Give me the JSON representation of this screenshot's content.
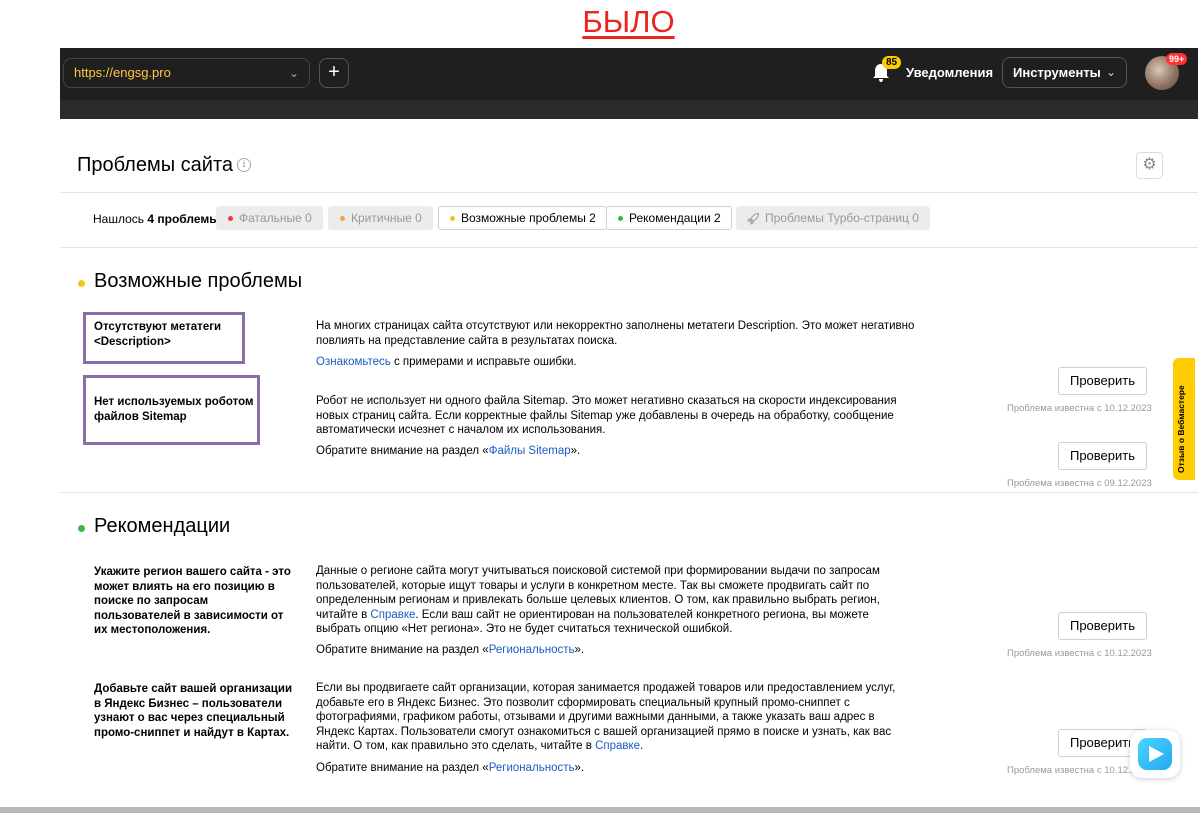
{
  "slide_title": "БЫЛО",
  "header": {
    "url": "https://engsg.pro",
    "notifications": {
      "count": "85",
      "label": "Уведомления"
    },
    "tools_label": "Инструменты",
    "avatar_badge": "99+"
  },
  "page": {
    "title": "Проблемы сайта",
    "found_prefix": "Нашлось",
    "found_count": "4 проблемы",
    "filters": [
      {
        "label": "Фатальные 0",
        "color": "#f03c3c",
        "active": false
      },
      {
        "label": "Критичные 0",
        "color": "#f5a54a",
        "active": false
      },
      {
        "label": "Возможные проблемы 2",
        "color": "#f5c518",
        "active": true
      },
      {
        "label": "Рекомендации 2",
        "color": "#3cb84a",
        "active": true
      },
      {
        "label": "Проблемы Турбо-страниц 0",
        "icon": "rocket-icon",
        "active": false
      }
    ]
  },
  "sections": [
    {
      "title": "Возможные проблемы",
      "dot_color": "#f5c518",
      "items": [
        {
          "title": "Отсутствуют метатеги <Description>",
          "description": "На многих страницах сайта отсутствуют или некорректно заполнены метатеги Description. Это может негативно повлиять на представление сайта в результатах поиска.",
          "note_link": "Ознакомьтесь",
          "note_after": " с примерами и исправьте ошибки.",
          "button": "Проверить",
          "known": "Проблема известна с 10.12.2023"
        },
        {
          "title": "Нет используемых роботом файлов Sitemap",
          "description": "Робот не использует ни одного файла Sitemap. Это может негативно сказаться на скорости индексирования новых страниц сайта. Если корректные файлы Sitemap уже добавлены в очередь на обработку, сообщение автоматически исчезнет с началом их использования.",
          "note_before": "Обратите внимание на раздел «",
          "note_link": "Файлы Sitemap",
          "note_after": "».",
          "button": "Проверить",
          "known": "Проблема известна с 09.12.2023"
        }
      ]
    },
    {
      "title": "Рекомендации",
      "dot_color": "#3cb84a",
      "items": [
        {
          "title": "Укажите регион вашего сайта - это может влиять на его позицию в поиске по запросам пользователей в зависимости от их местоположения.",
          "description_before": "Данные о регионе сайта могут учитываться поисковой системой при формировании выдачи по запросам пользователей, которые ищут товары и услуги в конкретном месте. Так вы сможете продвигать сайт по определенным регионам и привлекать больше целевых клиентов. О том, как правильно выбрать регион, читайте в ",
          "description_link": "Справке",
          "description_after": ". Если ваш сайт не ориентирован на пользователей конкретного региона, вы можете выбрать опцию «Нет региона». Это не будет считаться технической ошибкой.",
          "note_before": "Обратите внимание на раздел «",
          "note_link": "Региональность",
          "note_after": "».",
          "button": "Проверить",
          "known": "Проблема известна с 10.12.2023"
        },
        {
          "title": "Добавьте сайт вашей организации в Яндекс Бизнес – пользователи узнают о вас через специальный промо-сниппет и найдут в Картах.",
          "description_before": "Если вы продвигаете сайт организации, которая занимается продажей товаров или предоставлением услуг, добавьте его в Яндекс Бизнес. Это позволит сформировать специальный крупный промо-сниппет с фотографиями, графиком работы, отзывами и другими важными данными, а также указать ваш адрес в Яндекс Картах. Пользователи смогут ознакомиться с вашей организацией прямо в поиске и узнать, как вас найти. О том, как правильно это сделать, читайте в ",
          "description_link": "Справке",
          "description_after": ".",
          "note_before": "Обратите внимание на раздел «",
          "note_link": "Региональность",
          "note_after": "».",
          "button": "Проверить",
          "known": "Проблема известна с 10.12.2023"
        }
      ]
    }
  ],
  "feedback_tab": "Отзыв о Вебмастере"
}
